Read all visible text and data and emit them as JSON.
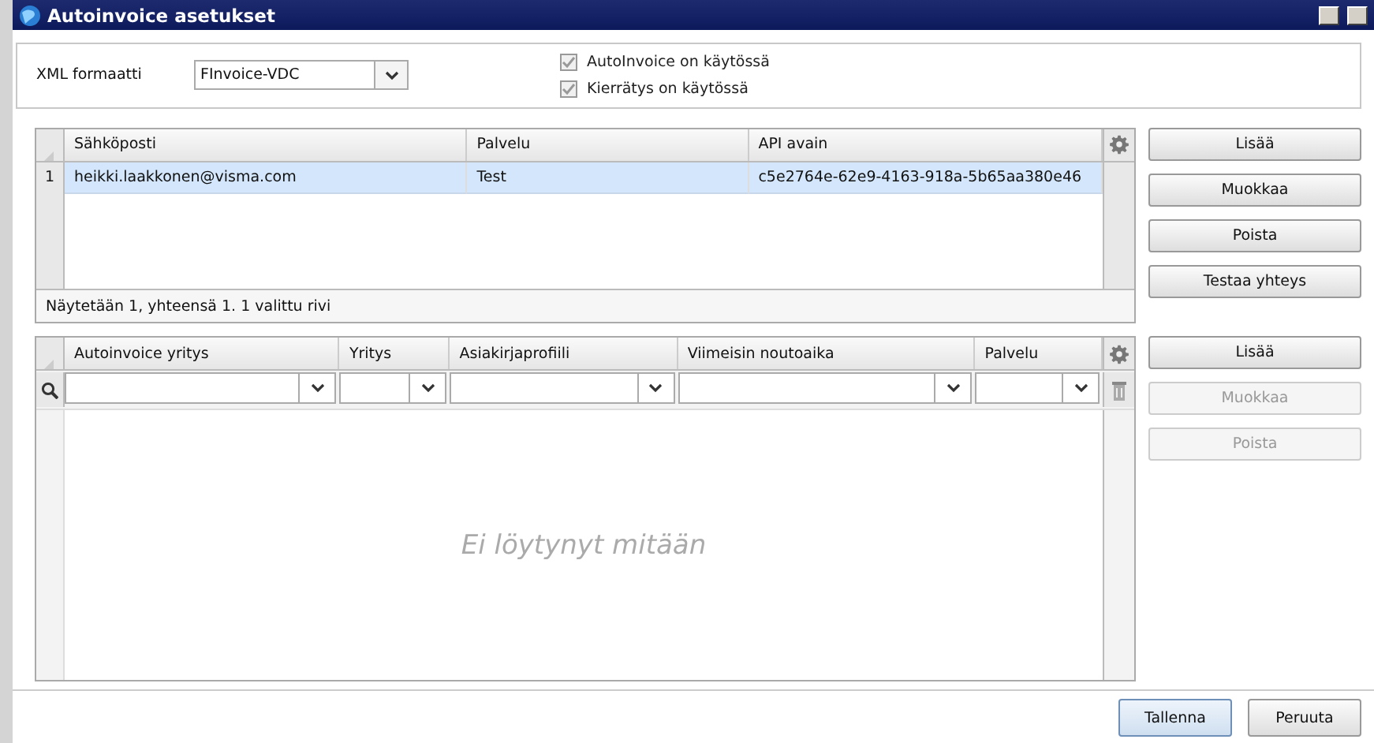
{
  "window": {
    "title": "Autoinvoice asetukset"
  },
  "settings": {
    "xml_format": {
      "label": "XML formaatti",
      "value": "FInvoice-VDC"
    },
    "checkboxes": [
      {
        "label": "AutoInvoice on käytössä",
        "checked": true,
        "disabled": true
      },
      {
        "label": "Kierrätys on käytössä",
        "checked": true,
        "disabled": true
      }
    ]
  },
  "services_table": {
    "columns": [
      "Sähköposti",
      "Palvelu",
      "API avain"
    ],
    "rows": [
      {
        "number": "1",
        "cells": [
          "heikki.laakkonen@visma.com",
          "Test",
          "c5e2764e-62e9-4163-918a-5b65aa380e46"
        ],
        "selected": true
      }
    ],
    "status": "Näytetään 1, yhteensä 1. 1 valittu rivi",
    "buttons": [
      {
        "label": "Lisää",
        "disabled": false
      },
      {
        "label": "Muokkaa",
        "disabled": false
      },
      {
        "label": "Poista",
        "disabled": false
      },
      {
        "label": "Testaa yhteys",
        "disabled": false
      }
    ]
  },
  "companies_table": {
    "columns": [
      "Autoinvoice yritys",
      "Yritys",
      "Asiakirjaprofiili",
      "Viimeisin noutoaika",
      "Palvelu"
    ],
    "empty_message": "Ei löytynyt mitään",
    "buttons": [
      {
        "label": "Lisää",
        "disabled": false
      },
      {
        "label": "Muokkaa",
        "disabled": true
      },
      {
        "label": "Poista",
        "disabled": true
      }
    ]
  },
  "footer_buttons": [
    {
      "label": "Tallenna",
      "default": true
    },
    {
      "label": "Peruuta",
      "default": false
    }
  ]
}
